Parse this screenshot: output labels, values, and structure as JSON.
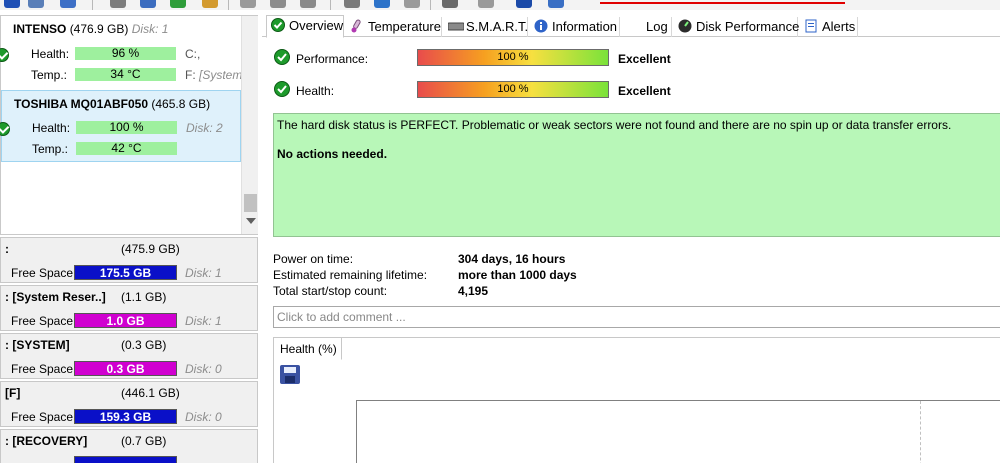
{
  "tabs": [
    {
      "label": "Overview",
      "icon": "check-circle-icon"
    },
    {
      "label": "Temperature",
      "icon": "thermometer-icon"
    },
    {
      "label": "S.M.A.R.T.",
      "icon": "disk-drive-icon"
    },
    {
      "label": "Information",
      "icon": "info-icon"
    },
    {
      "label": "Log",
      "icon": ""
    },
    {
      "label": "Disk Performance",
      "icon": "gauge-icon"
    },
    {
      "label": "Alerts",
      "icon": "document-icon"
    }
  ],
  "disks": [
    {
      "name": "INTENSO",
      "size": "(476.9 GB)",
      "disk": "Disk: 1",
      "health_label": "Health:",
      "health": "96 %",
      "temp_label": "Temp.:",
      "temp": "34 °C",
      "drive1": "C:,",
      "drive2": "F: [System"
    },
    {
      "name": "TOSHIBA MQ01ABF050",
      "size": "(465.8 GB)",
      "disk": "Disk: 2",
      "health_label": "Health:",
      "health": "100 %",
      "temp_label": "Temp.:",
      "temp": "42 °C"
    }
  ],
  "partitions": [
    {
      "name": ":",
      "size": "(475.9 GB)",
      "free_label": "Free Space",
      "free": "175.5 GB",
      "disk": "Disk: 1",
      "color": "#0a10c8"
    },
    {
      "name": ": [System Reser..]",
      "size": "(1.1 GB)",
      "free_label": "Free Space",
      "free": "1.0 GB",
      "disk": "Disk: 1",
      "color": "#d000d0"
    },
    {
      "name": ": [SYSTEM]",
      "size": "(0.3 GB)",
      "free_label": "Free Space",
      "free": "0.3 GB",
      "disk": "Disk: 0",
      "color": "#d000d0"
    },
    {
      "name": "[F]",
      "size": "(446.1 GB)",
      "free_label": "Free Space",
      "free": "159.3 GB",
      "disk": "Disk: 0",
      "color": "#0a10c8"
    },
    {
      "name": ": [RECOVERY]",
      "size": "(0.7 GB)",
      "free_label": "",
      "free": "",
      "disk": "",
      "color": "#0a10c8"
    }
  ],
  "overview": {
    "performance_label": "Performance:",
    "performance_value": "100 %",
    "performance_rating": "Excellent",
    "health_label": "Health:",
    "health_value": "100 %",
    "health_rating": "Excellent",
    "status_text": "The hard disk status is PERFECT. Problematic or weak sectors were not found and there are no spin up or data transfer errors.",
    "status_action": "No actions needed.",
    "power_on_label": "Power on time:",
    "power_on_value": "304 days, 16 hours",
    "lifetime_label": "Estimated remaining lifetime:",
    "lifetime_value": "more than 1000 days",
    "startstop_label": "Total start/stop count:",
    "startstop_value": "4,195",
    "comment_placeholder": "Click to add comment ...",
    "graph_tab": "Health (%)"
  },
  "colors": {
    "selected_disk_bg": "#dff1fb",
    "status_bg": "#b8f7b8",
    "bar_green": "#9ef09e"
  }
}
